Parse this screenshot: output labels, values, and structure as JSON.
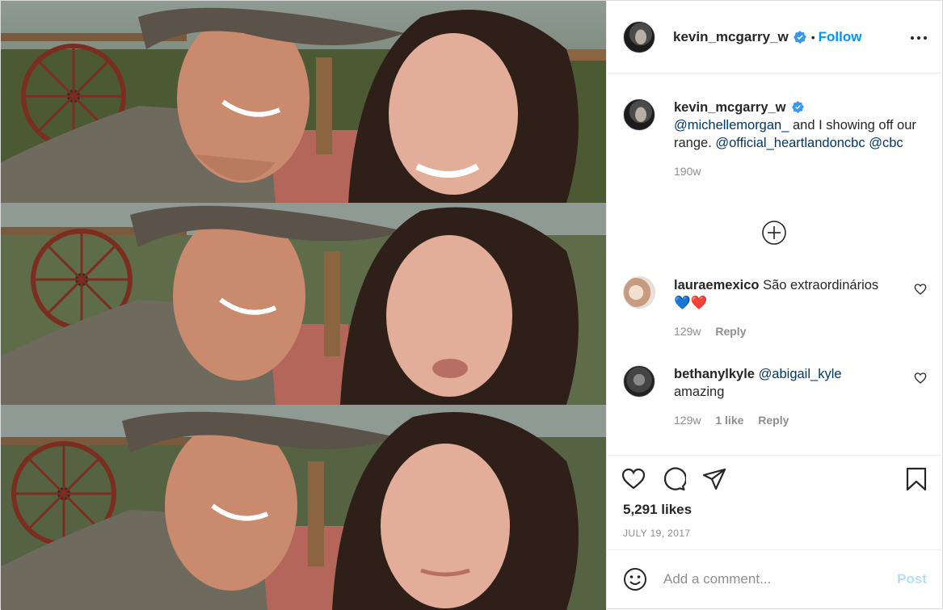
{
  "post": {
    "author": {
      "username": "kevin_mcgarry_w",
      "verified": true,
      "follow_label": "Follow",
      "separator": "•"
    },
    "caption": {
      "username": "kevin_mcgarry_w",
      "parts": [
        "@michellemorgan_",
        " and I showing off our range. ",
        "@official_heartlandoncbc",
        " ",
        "@cbc"
      ],
      "time": "190w"
    },
    "comments": [
      {
        "username": "lauraemexico",
        "text": "São extraordinários",
        "emoji": "💙❤️",
        "time": "129w",
        "reply_label": "Reply"
      },
      {
        "username": "bethanylkyle",
        "mention": "@abigail_kyle",
        "text": "amazing",
        "time": "129w",
        "likes_label": "1 like",
        "reply_label": "Reply"
      }
    ],
    "likes": "5,291 likes",
    "date": "JULY 19, 2017",
    "add_comment_placeholder": "Add a comment...",
    "post_button": "Post",
    "icons": {
      "more": "more-options-icon",
      "like": "heart-icon",
      "comment": "comment-bubble-icon",
      "share": "paper-plane-icon",
      "save": "bookmark-icon",
      "load_more": "plus-circle-icon",
      "emoji": "smiley-icon",
      "verified": "verified-badge-icon"
    },
    "colors": {
      "accent": "#0095f6",
      "mention": "#00376b",
      "muted": "#8e8e8e",
      "post_disabled": "#b2dffc",
      "border": "#dbdbdb"
    }
  }
}
